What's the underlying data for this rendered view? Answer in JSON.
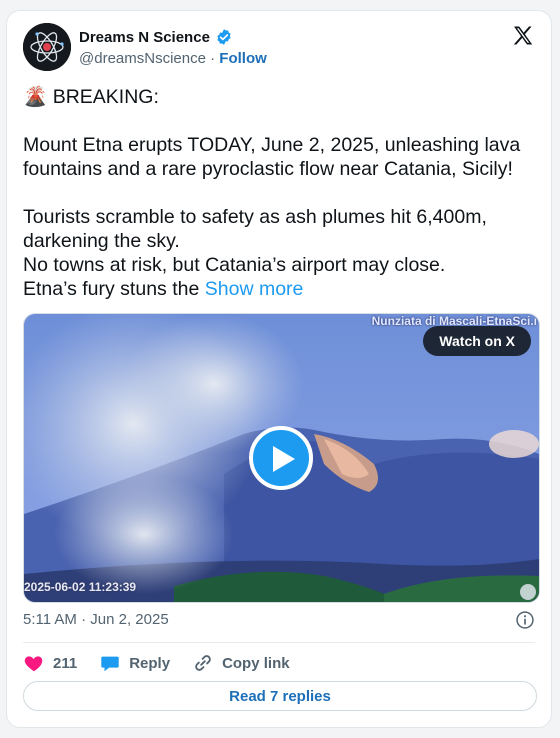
{
  "author": {
    "name": "Dreams N Science",
    "handle": "@dreamsNscience",
    "separator": "·",
    "follow_label": "Follow"
  },
  "post": {
    "emoji": "🌋",
    "line_breaking": "BREAKING:",
    "para1": "Mount Etna erupts TODAY, June 2, 2025, unleashing lava fountains and a rare pyroclastic flow near Catania, Sicily!",
    "para2_line1": "Tourists scramble to safety as ash plumes hit 6,400m, darkening the sky.",
    "para2_line2": "No towns at risk, but Catania’s airport may close.",
    "para2_line3": "Etna’s fury stuns the",
    "show_more": "Show more"
  },
  "media": {
    "watch_label": "Watch on X",
    "credit": "Nunziata di Mascali-EtnaSci.i",
    "timestamp": "2025-06-02 11:23:39"
  },
  "meta": {
    "time": "5:11 AM",
    "separator": "·",
    "date": "Jun 2, 2025"
  },
  "actions": {
    "likes": "211",
    "reply_label": "Reply",
    "copy_label": "Copy link"
  },
  "replies_button": "Read 7 replies",
  "colors": {
    "accent": "#1d9bf0",
    "link_dark": "#1d6fb8",
    "heart": "#f91880",
    "verified": "#1d9bf0"
  },
  "icons": [
    "avatar-atom-icon",
    "verified-badge-icon",
    "x-logo-icon",
    "volcano-emoji",
    "play-icon",
    "info-icon",
    "heart-icon",
    "reply-bubble-icon",
    "link-icon"
  ]
}
